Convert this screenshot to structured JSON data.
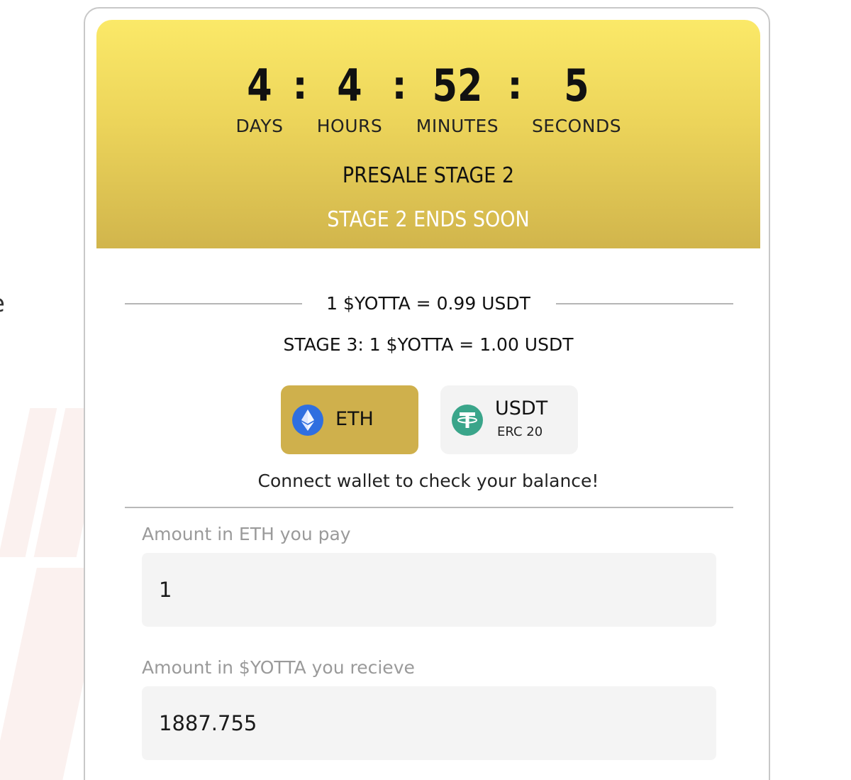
{
  "background": {
    "edge_glyph": "e"
  },
  "timer": {
    "days": "4",
    "hours": "4",
    "minutes": "52",
    "seconds": "5",
    "separator": ":",
    "labels": {
      "days": "DAYS",
      "hours": "HOURS",
      "minutes": "MINUTES",
      "seconds": "SECONDS"
    }
  },
  "stage": {
    "title": "PRESALE STAGE 2",
    "ends": "STAGE 2 ENDS SOON"
  },
  "price": {
    "current": "1 $YOTTA = 0.99 USDT",
    "next": "STAGE 3: 1 $YOTTA = 1.00 USDT"
  },
  "payment_options": {
    "eth": {
      "label": "ETH",
      "icon": "ethereum-icon",
      "selected": true
    },
    "usdt": {
      "label": "USDT",
      "sublabel": "ERC 20",
      "icon": "tether-icon",
      "selected": false
    }
  },
  "balance_message": "Connect wallet to check your balance!",
  "form": {
    "pay": {
      "label": "Amount in ETH you pay",
      "value": "1"
    },
    "receive": {
      "label": "Amount in $YOTTA you recieve",
      "value": "1887.755"
    }
  },
  "colors": {
    "hero_top": "#fbe968",
    "hero_bottom": "#d1b54c",
    "eth_selected": "#cfb04c",
    "eth_coin": "#2f6fe0",
    "usdt_coin": "#3aa58a"
  }
}
